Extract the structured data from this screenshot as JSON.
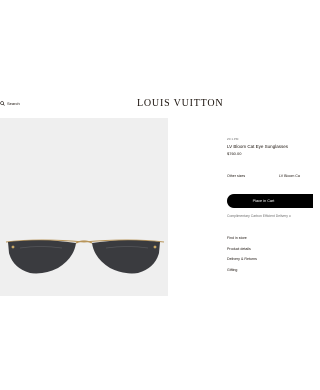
{
  "header": {
    "search_label": "Search",
    "logo_text": "LOUIS VUITTON"
  },
  "product": {
    "reference": "Z0 1.PM",
    "name": "LV Bloom Cat Eye Sunglasses",
    "price": "$760.00",
    "sizes_label": "Other sizes",
    "selected_size": "LV Bloom Ca",
    "cart_button_label": "Place in Cart",
    "delivery_note": "Complimentary Carbon Efficient Delivery o",
    "image_background": "#efefef",
    "lens_color": "#3a3b3f",
    "frame_color": "#b8955a"
  },
  "links": [
    {
      "label": "Find in store"
    },
    {
      "label": "Product details"
    },
    {
      "label": "Delivery & Returns"
    },
    {
      "label": "Gifting"
    }
  ]
}
